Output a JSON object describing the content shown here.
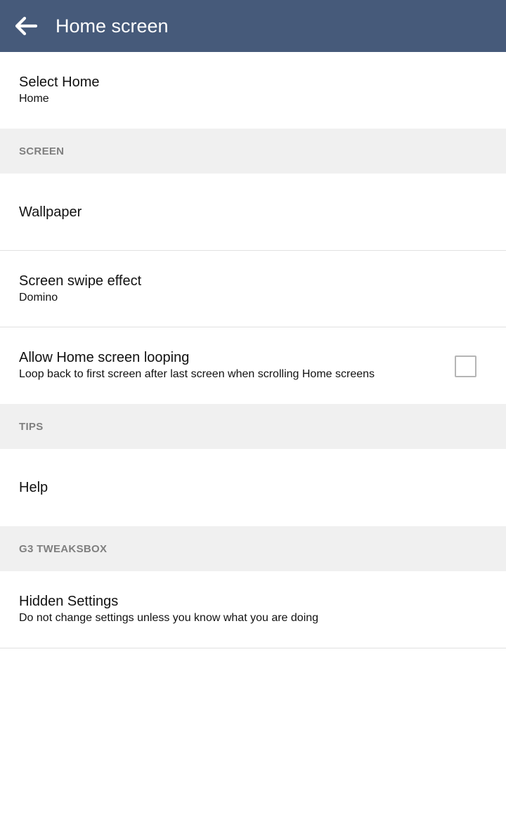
{
  "header": {
    "title": "Home screen",
    "back_icon": "arrow-left-icon"
  },
  "items": {
    "select_home": {
      "title": "Select Home",
      "summary": "Home"
    },
    "wallpaper": {
      "title": "Wallpaper"
    },
    "swipe_effect": {
      "title": "Screen swipe effect",
      "summary": "Domino"
    },
    "looping": {
      "title": "Allow Home screen looping",
      "summary": "Loop back to first screen after last screen when scrolling Home screens",
      "checked": false
    },
    "help": {
      "title": "Help"
    },
    "hidden_settings": {
      "title": "Hidden Settings",
      "summary": "Do not change settings unless you know what you are doing"
    }
  },
  "categories": {
    "screen": "SCREEN",
    "tips": "TIPS",
    "tweaksbox": "G3 TWEAKSBOX"
  },
  "colors": {
    "app_bar": "#465a7a",
    "category_bg": "#f0f0f0",
    "category_text": "#7f7f7f",
    "divider": "#e1e1e1"
  }
}
